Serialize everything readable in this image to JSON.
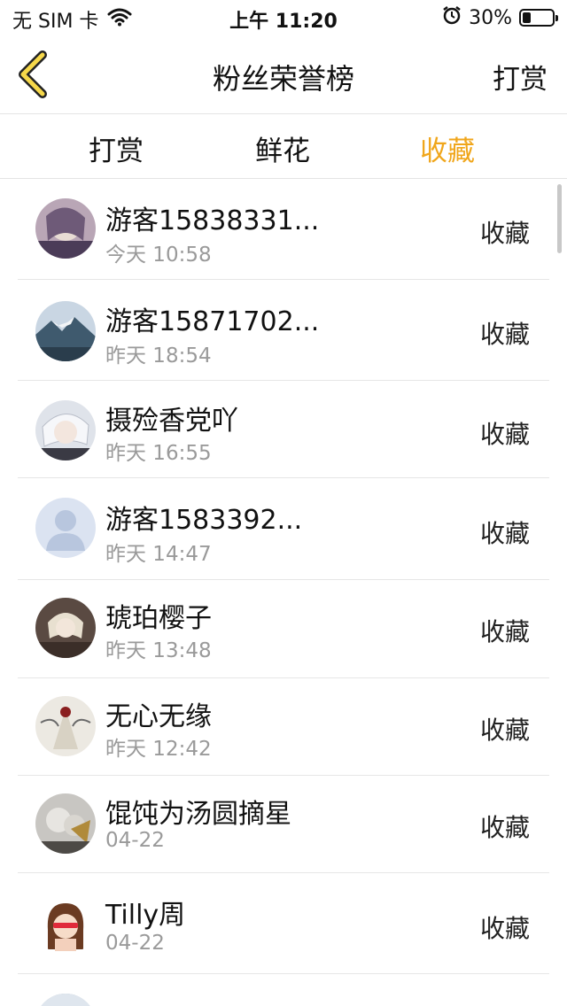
{
  "status_bar": {
    "carrier": "无 SIM 卡",
    "time": "上午 11:20",
    "battery": "30%"
  },
  "nav": {
    "title": "粉丝荣誉榜",
    "right_action": "打赏"
  },
  "tabs": [
    {
      "label": "打赏",
      "active": false
    },
    {
      "label": "鲜花",
      "active": false
    },
    {
      "label": "收藏",
      "active": true
    }
  ],
  "accent_color": "#f0a61b",
  "list": [
    {
      "name": "游客15838331...",
      "time": "今天 10:58",
      "action": "收藏"
    },
    {
      "name": "游客15871702...",
      "time": "昨天 18:54",
      "action": "收藏"
    },
    {
      "name": "摄殓香党吖",
      "time": "昨天 16:55",
      "action": "收藏"
    },
    {
      "name": "游客1583392...",
      "time": "昨天 14:47",
      "action": "收藏"
    },
    {
      "name": "琥珀樱子",
      "time": "昨天 13:48",
      "action": "收藏"
    },
    {
      "name": "无心无缘",
      "time": "昨天 12:42",
      "action": "收藏"
    },
    {
      "name": "馄饨为汤圆摘星",
      "time": "04-22",
      "action": "收藏"
    },
    {
      "name": "Tilly周",
      "time": "04-22",
      "action": "收藏"
    }
  ]
}
